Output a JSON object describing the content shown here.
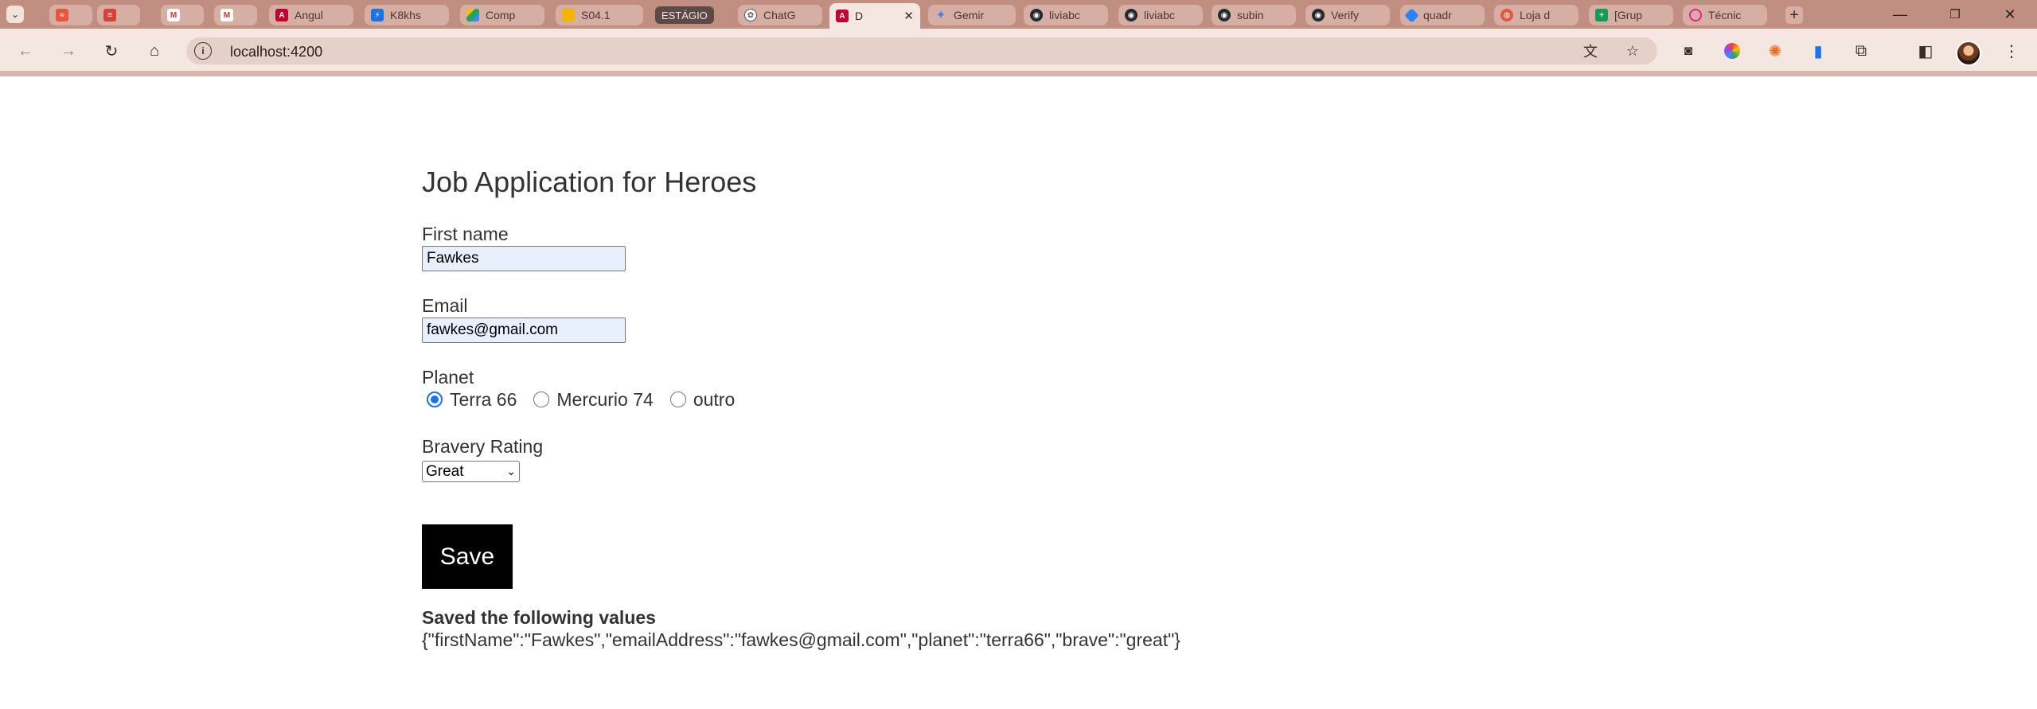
{
  "browser": {
    "tabs": [
      {
        "label": "",
        "favicon": "red-waves-icon",
        "color": "#e8553d"
      },
      {
        "label": "",
        "favicon": "todoist-icon",
        "color": "#db4035"
      },
      {
        "label": "",
        "favicon": "gmail-icon",
        "color": "#d93025"
      },
      {
        "label": "",
        "favicon": "gmail-icon",
        "color": "#d93025"
      },
      {
        "label": "Angul",
        "favicon": "angular-icon",
        "color": "#c3002f"
      },
      {
        "label": "K8khs",
        "favicon": "lightning-icon",
        "color": "#1a73e8"
      },
      {
        "label": "Comp",
        "favicon": "google-drive-icon",
        "color": "#1fa463"
      },
      {
        "label": "S04.1",
        "favicon": "google-slides-icon",
        "color": "#f4b400"
      },
      {
        "label": "ChatG",
        "favicon": "chatgpt-icon",
        "color": "#555555"
      },
      {
        "label": "D",
        "favicon": "angular-icon",
        "color": "#c3002f"
      },
      {
        "label": "Gemir",
        "favicon": "gemini-icon",
        "color": "#4285f4"
      },
      {
        "label": "liviabc",
        "favicon": "github-icon",
        "color": "#24292e"
      },
      {
        "label": "liviabc",
        "favicon": "github-icon",
        "color": "#24292e"
      },
      {
        "label": "subin",
        "favicon": "github-icon",
        "color": "#24292e"
      },
      {
        "label": "Verify",
        "favicon": "github-icon",
        "color": "#24292e"
      },
      {
        "label": "quadr",
        "favicon": "jira-icon",
        "color": "#2684ff"
      },
      {
        "label": "Loja d",
        "favicon": "store-icon",
        "color": "#e8553d"
      },
      {
        "label": "[Grup",
        "favicon": "google-sheets-icon",
        "color": "#0f9d58"
      },
      {
        "label": "Técnic",
        "favicon": "hexagon-icon",
        "color": "#e91e8c"
      }
    ],
    "tab_group_label": "ESTÁGIO",
    "active_tab_index": 9,
    "address": "localhost:4200",
    "theme_color": "#c08f82"
  },
  "form": {
    "title": "Job Application for Heroes",
    "first_name_label": "First name",
    "first_name_value": "Fawkes",
    "email_label": "Email",
    "email_value": "fawkes@gmail.com",
    "planet_label": "Planet",
    "planet_options": [
      "Terra 66",
      "Mercurio 74",
      "outro"
    ],
    "planet_selected": "Terra 66",
    "bravery_label": "Bravery Rating",
    "bravery_value": "Great",
    "save_label": "Save"
  },
  "result": {
    "heading": "Saved the following values",
    "json": "{\"firstName\":\"Fawkes\",\"emailAddress\":\"fawkes@gmail.com\",\"planet\":\"terra66\",\"brave\":\"great\"}"
  }
}
